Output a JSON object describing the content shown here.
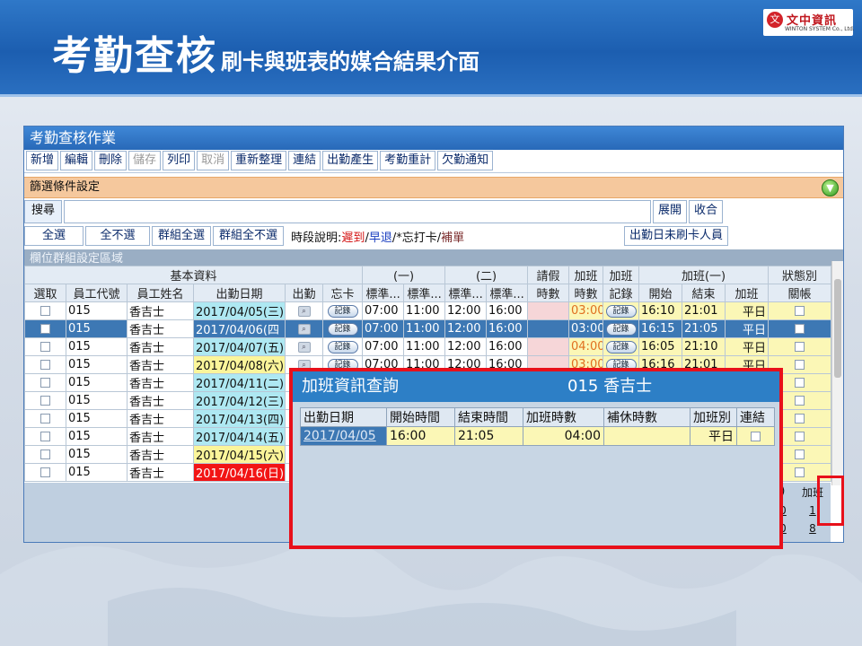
{
  "slide": {
    "title_big": "考勤查核",
    "title_small": "刷卡與班表的媒合結果介面",
    "logo_cn": "文中資訊",
    "logo_en": "WINTON SYSTEM Co., Ltd."
  },
  "colors": {
    "header_blue": "#1c5eb0",
    "filter_orange": "#f5c89d",
    "selected_row": "#3d78b4",
    "late_red": "#d41414",
    "highlight_frame": "#e8101a"
  },
  "app": {
    "title": "考勤查核作業",
    "toolbar": [
      {
        "label": "新增",
        "enabled": true
      },
      {
        "label": "編輯",
        "enabled": true
      },
      {
        "label": "刪除",
        "enabled": true
      },
      {
        "label": "儲存",
        "enabled": false
      },
      {
        "label": "列印",
        "enabled": true
      },
      {
        "label": "取消",
        "enabled": false
      },
      {
        "label": "重新整理",
        "enabled": true
      },
      {
        "label": "連結",
        "enabled": true
      },
      {
        "label": "出勤產生",
        "enabled": true
      },
      {
        "label": "考勤重計",
        "enabled": true
      },
      {
        "label": "欠勤通知",
        "enabled": true
      }
    ],
    "filter_label": "篩選條件設定",
    "search_label": "搜尋",
    "expand_label": "展開",
    "collapse_label": "收合",
    "select_all": "全選",
    "deselect_all": "全不選",
    "group_select_all": "群組全選",
    "group_deselect_all": "群組全不選",
    "legend_prefix": "時段說明:",
    "legend_late": "遲到",
    "legend_sep1": "/",
    "legend_early": "早退",
    "legend_sep2": "/*忘打卡/",
    "legend_makeup": "補單",
    "no_punch_btn": "出勤日未刷卡人員",
    "group_area": "欄位群組設定區域"
  },
  "grid": {
    "group_headers": {
      "basic": "基本資料",
      "shift1": "(一)",
      "shift2": "(二)",
      "leave": "請假",
      "ot": "加班",
      "ot2": "加班",
      "ot_one": "加班(一)",
      "status": "狀態別"
    },
    "columns": {
      "select": "選取",
      "emp_code": "員工代號",
      "emp_name": "員工姓名",
      "date": "出勤日期",
      "attend": "出勤",
      "forgot": "忘卡",
      "s1_std_in": "標準...",
      "s1_std_out": "標準...",
      "s2_std_in": "標準...",
      "s2_std_out": "標準...",
      "leave_hours": "時數",
      "ot_hours": "時數",
      "ot_record": "記錄",
      "ot_start": "開始",
      "ot_end": "結束",
      "ot_type": "加班",
      "closed": "關帳"
    },
    "record_label": "記錄",
    "rows": [
      {
        "code": "015",
        "name": "香吉士",
        "date": "2017/04/05(三)",
        "date_color": "cyan",
        "s1a": "07:00",
        "s1b": "11:00",
        "s2a": "12:00",
        "s2b": "16:00",
        "ot_hours": "03:00",
        "ot_start": "16:10",
        "ot_end": "21:01",
        "ot_type": "平日"
      },
      {
        "code": "015",
        "name": "香吉士",
        "date": "2017/04/06(四",
        "date_color": "selected",
        "s1a": "07:00",
        "s1b": "11:00",
        "s2a": "12:00",
        "s2b": "16:00",
        "ot_hours": "03:00",
        "ot_start": "16:15",
        "ot_end": "21:05",
        "ot_type": "平日"
      },
      {
        "code": "015",
        "name": "香吉士",
        "date": "2017/04/07(五)",
        "date_color": "cyan",
        "s1a": "07:00",
        "s1b": "11:00",
        "s2a": "12:00",
        "s2b": "16:00",
        "ot_hours": "04:00",
        "ot_start": "16:05",
        "ot_end": "21:10",
        "ot_type": "平日"
      },
      {
        "code": "015",
        "name": "香吉士",
        "date": "2017/04/08(六)",
        "date_color": "yellow",
        "s1a": "07:00",
        "s1b": "11:00",
        "s2a": "12:00",
        "s2b": "16:00",
        "ot_hours": "03:00",
        "ot_start": "16:16",
        "ot_end": "21:01",
        "ot_type": "平日"
      },
      {
        "code": "015",
        "name": "香吉士",
        "date": "2017/04/11(二)",
        "date_color": "cyan"
      },
      {
        "code": "015",
        "name": "香吉士",
        "date": "2017/04/12(三)",
        "date_color": "cyan"
      },
      {
        "code": "015",
        "name": "香吉士",
        "date": "2017/04/13(四)",
        "date_color": "cyan"
      },
      {
        "code": "015",
        "name": "香吉士",
        "date": "2017/04/14(五)",
        "date_color": "cyan"
      },
      {
        "code": "015",
        "name": "香吉士",
        "date": "2017/04/15(六)",
        "date_color": "yellow"
      },
      {
        "code": "015",
        "name": "香吉士",
        "date": "2017/04/16(日)",
        "date_color": "red"
      }
    ],
    "summary_header_a": ")",
    "summary_header_ot": "加班",
    "summary_row1": [
      "0",
      "1"
    ],
    "summary_row2": [
      "0",
      "8"
    ]
  },
  "popup": {
    "title": "加班資訊查詢",
    "employee": "015 香吉士",
    "headers": [
      "出勤日期",
      "開始時間",
      "結束時間",
      "加班時數",
      "補休時數",
      "加班別",
      "連結"
    ],
    "row": {
      "date": "2017/04/05",
      "start": "16:00",
      "end": "21:05",
      "ot_hours": "04:00",
      "comp_hours": "",
      "ot_type": "平日"
    }
  }
}
